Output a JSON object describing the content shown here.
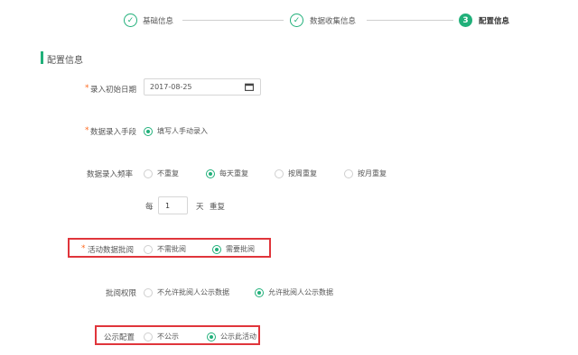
{
  "steps": [
    {
      "label": "基础信息",
      "state": "done",
      "icon": "check-icon"
    },
    {
      "label": "数据收集信息",
      "state": "done",
      "icon": "check-icon"
    },
    {
      "label": "配置信息",
      "state": "active",
      "number": "3"
    }
  ],
  "section": {
    "title": "配置信息"
  },
  "form": {
    "start_date": {
      "label": "录入初始日期",
      "required": "*",
      "value": "2017-08-25",
      "icon": "calendar-icon"
    },
    "entry_method": {
      "label": "数据录入手段",
      "required": "*",
      "option": "填写人手动录入",
      "selected": true
    },
    "frequency": {
      "label": "数据录入频率",
      "options": [
        "不重复",
        "每天重复",
        "按周重复",
        "按月重复"
      ],
      "selected_index": 1
    },
    "repeat_every": {
      "prefix": "每",
      "value": "1",
      "unit": "天",
      "suffix": "重复"
    },
    "approval": {
      "label": "活动数据批阅",
      "required": "*",
      "options": [
        "不需批阅",
        "需要批阅"
      ],
      "selected_index": 1
    },
    "permission": {
      "label": "批阅权限",
      "options": [
        "不允许批阅人公示数据",
        "允许批阅人公示数据"
      ],
      "selected_index": 1
    },
    "publish": {
      "label": "公示配置",
      "options": [
        "不公示",
        "公示此活动"
      ],
      "selected_index": 1
    }
  },
  "colors": {
    "accent": "#21b07a",
    "required": "#ff6a1f",
    "highlight": "#e0353b"
  }
}
